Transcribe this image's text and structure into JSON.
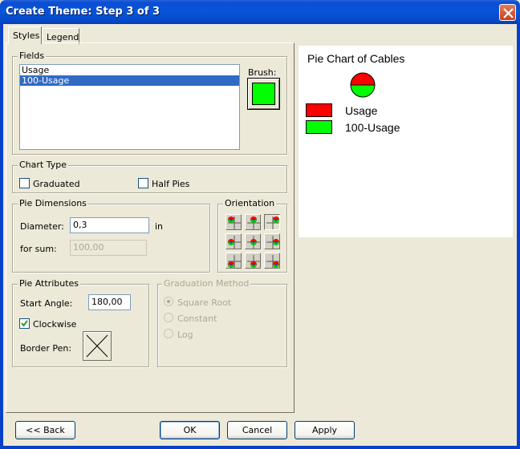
{
  "window": {
    "title": "Create Theme: Step 3 of 3"
  },
  "tabs": [
    {
      "label": "Styles"
    },
    {
      "label": "Legend"
    }
  ],
  "fields": {
    "group_label": "Fields",
    "items": [
      "Usage",
      "100-Usage"
    ],
    "selected": "100-Usage",
    "brush_label": "Brush:",
    "brush_color": "#00ff00"
  },
  "chart_type": {
    "group_label": "Chart Type",
    "graduated": {
      "label": "Graduated",
      "checked": false
    },
    "half_pies": {
      "label": "Half Pies",
      "checked": false
    }
  },
  "pie_dimensions": {
    "group_label": "Pie Dimensions",
    "diameter_label": "Diameter:",
    "diameter_value": "0,3",
    "diameter_unit": "in",
    "sum_label": "for sum:",
    "sum_value": "100,00"
  },
  "orientation": {
    "group_label": "Orientation",
    "selected": "top-right"
  },
  "pie_attributes": {
    "group_label": "Pie Attributes",
    "start_angle_label": "Start Angle:",
    "start_angle_value": "180,00",
    "clockwise_label": "Clockwise",
    "clockwise_checked": true,
    "border_pen_label": "Border Pen:"
  },
  "graduation_method": {
    "group_label": "Graduation Method",
    "options": [
      "Square Root",
      "Constant",
      "Log"
    ],
    "selected": "Square Root"
  },
  "preview": {
    "title": "Pie Chart of Cables",
    "legend": [
      {
        "label": "Usage",
        "color": "#ff0000"
      },
      {
        "label": "100-Usage",
        "color": "#00ff00"
      }
    ]
  },
  "buttons": {
    "back": "<< Back",
    "ok": "OK",
    "cancel": "Cancel",
    "apply": "Apply"
  }
}
